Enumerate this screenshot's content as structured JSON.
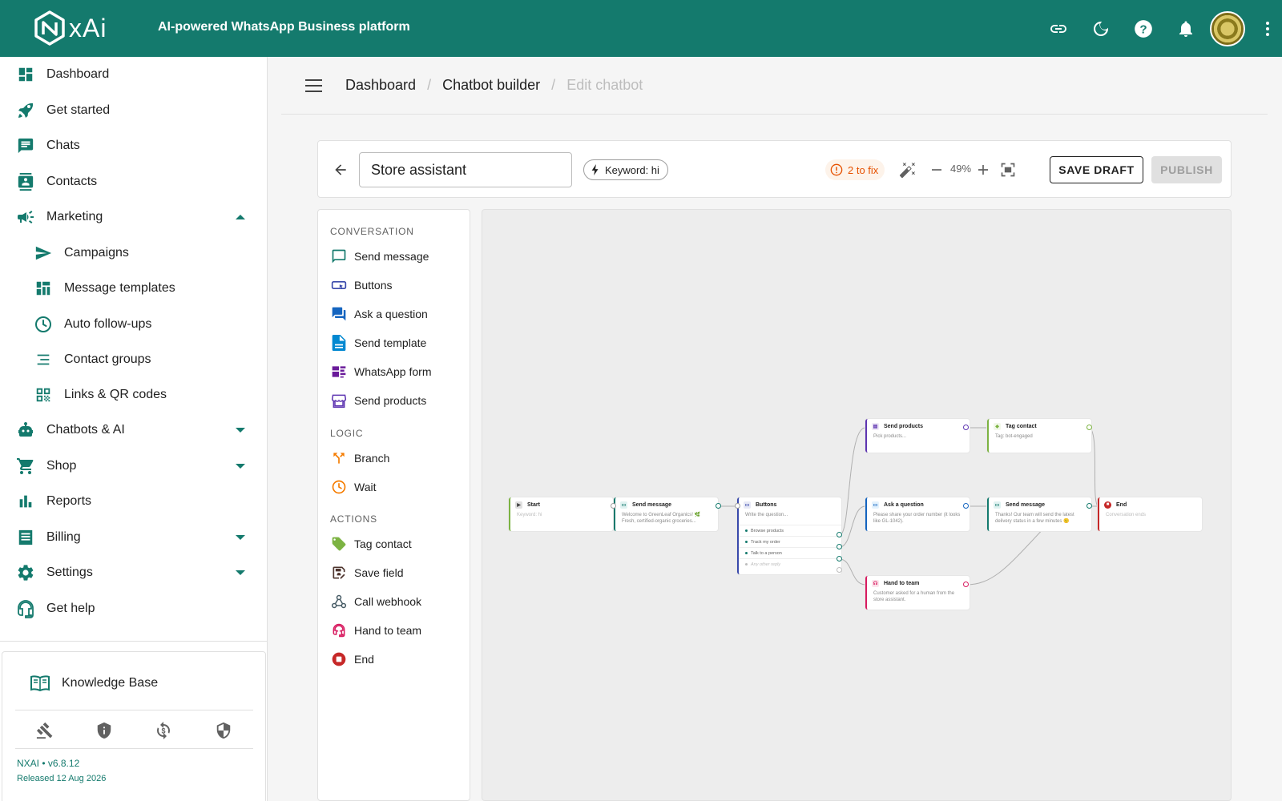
{
  "app": {
    "logo_text": "xAi",
    "tagline": "AI-powered WhatsApp Business platform",
    "top_icons": [
      "link-icon",
      "dark-mode-icon",
      "help-icon",
      "notifications-icon",
      "avatar",
      "more-vert-icon"
    ]
  },
  "sidebar": {
    "items": [
      {
        "label": "Dashboard",
        "icon": "dashboard-icon"
      },
      {
        "label": "Get started",
        "icon": "rocket-icon"
      },
      {
        "label": "Chats",
        "icon": "chat-icon"
      },
      {
        "label": "Contacts",
        "icon": "contacts-icon"
      },
      {
        "label": "Marketing",
        "icon": "megaphone-icon",
        "expanded": true
      },
      {
        "label": "Campaigns",
        "icon": "send-icon"
      },
      {
        "label": "Message templates",
        "icon": "templates-icon"
      },
      {
        "label": "Auto follow-ups",
        "icon": "clock-icon"
      },
      {
        "label": "Contact groups",
        "icon": "list-icon"
      },
      {
        "label": "Links & QR codes",
        "icon": "qr-code-icon"
      },
      {
        "label": "Chatbots & AI",
        "icon": "robot-icon"
      },
      {
        "label": "Shop",
        "icon": "cart-icon"
      },
      {
        "label": "Reports",
        "icon": "bar-chart-icon"
      },
      {
        "label": "Billing",
        "icon": "receipt-icon"
      },
      {
        "label": "Settings",
        "icon": "gear-icon"
      },
      {
        "label": "Get help",
        "icon": "headset-icon"
      }
    ],
    "footer": {
      "knowledge_base": "Knowledge Base",
      "version": "NXAI • v6.8.12",
      "released": "Released 12 Aug 2026"
    }
  },
  "breadcrumb": {
    "items": [
      "Dashboard",
      "Chatbot builder",
      "Edit chatbot"
    ]
  },
  "toolbar": {
    "name_value": "Store assistant",
    "keyword_chip": "Keyword: hi",
    "fix_count": "2 to fix",
    "zoom": "49%",
    "save_draft": "SAVE DRAFT",
    "publish": "PUBLISH"
  },
  "palette": {
    "conversation_heading": "CONVERSATION",
    "conversation": [
      {
        "label": "Send message",
        "icon": "message-icon"
      },
      {
        "label": "Buttons",
        "icon": "buttons-icon"
      },
      {
        "label": "Ask a question",
        "icon": "question-icon"
      },
      {
        "label": "Send template",
        "icon": "template-icon"
      },
      {
        "label": "WhatsApp form",
        "icon": "form-icon"
      },
      {
        "label": "Send products",
        "icon": "store-icon"
      }
    ],
    "logic_heading": "LOGIC",
    "logic": [
      {
        "label": "Branch",
        "icon": "branch-icon"
      },
      {
        "label": "Wait",
        "icon": "clock-icon"
      }
    ],
    "actions_heading": "ACTIONS",
    "actions": [
      {
        "label": "Tag contact",
        "icon": "tag-icon"
      },
      {
        "label": "Save field",
        "icon": "save-field-icon"
      },
      {
        "label": "Call webhook",
        "icon": "webhook-icon"
      },
      {
        "label": "Hand to team",
        "icon": "support-agent-icon"
      },
      {
        "label": "End",
        "icon": "stop-icon"
      }
    ]
  },
  "flow": {
    "nodes": {
      "start": {
        "title": "Start",
        "body": "Keyword: hi",
        "color": "#9e9e9e"
      },
      "send_message_1": {
        "title": "Send message",
        "body": "Welcome to GreenLeaf Organics! 🌿 Fresh, certified-organic groceries...",
        "color": "#147a6d"
      },
      "buttons": {
        "title": "Buttons",
        "body": "Write the question...",
        "options": [
          "Browse products",
          "Track my order",
          "Talk to a person"
        ],
        "any_reply": "Any other reply",
        "color": "#3949ab"
      },
      "send_products": {
        "title": "Send products",
        "body": "Pick products...",
        "color": "#5e35b1"
      },
      "tag_contact": {
        "title": "Tag contact",
        "body": "Tag: bot-engaged",
        "color": "#7cb342"
      },
      "ask_question": {
        "title": "Ask a question",
        "body": "Please share your order number (it looks like GL-1042).",
        "color": "#1565c0"
      },
      "send_message_2": {
        "title": "Send message",
        "body": "Thanks! Our team will send the latest delivery status in a few minutes 🙂",
        "color": "#147a6d"
      },
      "end": {
        "title": "End",
        "body": "Conversation ends",
        "color": "#c62828"
      },
      "hand_to_team": {
        "title": "Hand to team",
        "body": "Customer asked for a human from the store assistant.",
        "color": "#d81b60"
      }
    }
  }
}
